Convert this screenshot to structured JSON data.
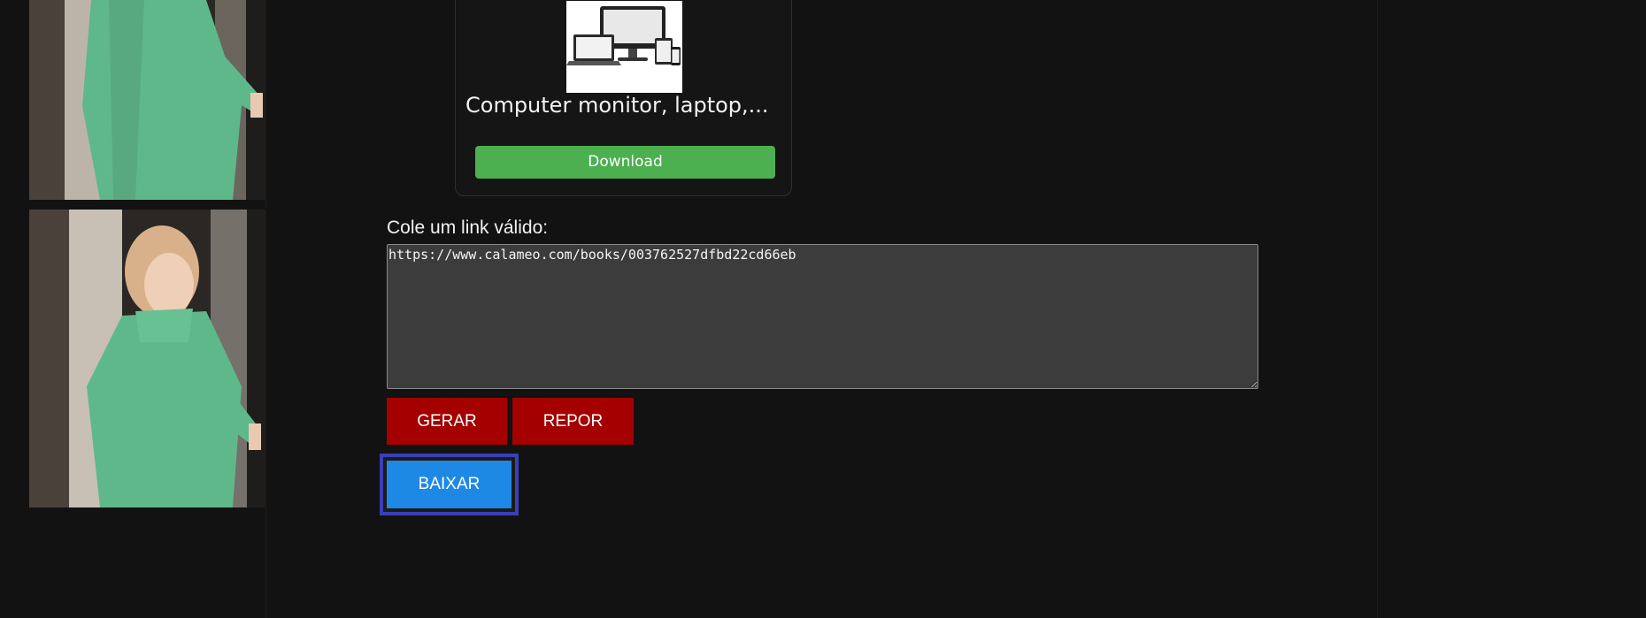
{
  "card": {
    "image_alt": "Computer monitor, laptop, tablet and phone devices",
    "title": "Computer monitor, laptop,...",
    "download_label": "Download",
    "download_color": "#4caf50"
  },
  "form": {
    "label": "Cole um link válido:",
    "link_value": "https://www.calameo.com/books/003762527dfbd22cd66eb",
    "gerar_label": "GERAR",
    "repor_label": "REPOR",
    "baixar_label": "BAIXAR",
    "primary_color": "#a50000",
    "accent_color": "#1e88e5"
  },
  "icons": [
    "devices-icon",
    "resize-grip-icon"
  ]
}
